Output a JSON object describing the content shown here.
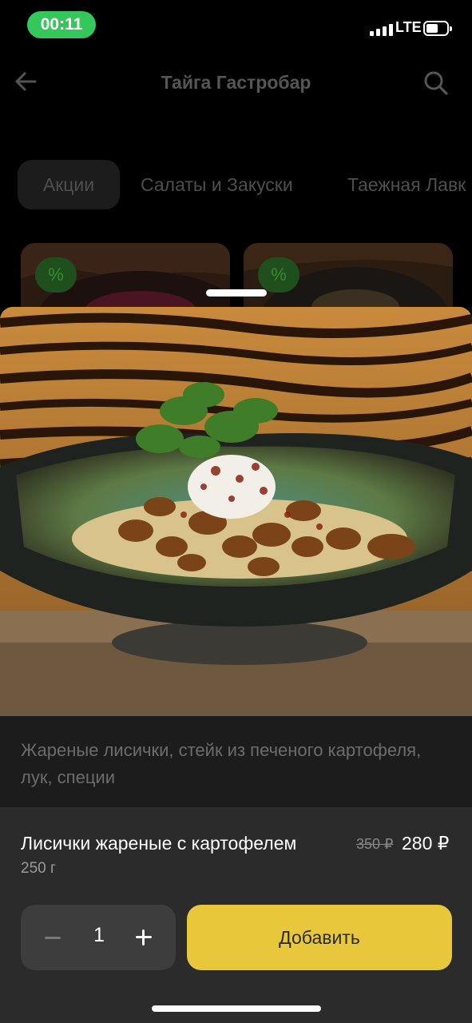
{
  "status_bar": {
    "time": "00:11",
    "network": "LTE"
  },
  "header": {
    "title": "Тайга Гастробар",
    "back_icon": "arrow-left-icon",
    "search_icon": "search-icon"
  },
  "tabs": [
    {
      "label": "Акции",
      "active": true
    },
    {
      "label": "Салаты и Закуски",
      "active": false
    },
    {
      "label": "Таежная Лавк",
      "active": false
    }
  ],
  "cards": [
    {
      "badge": "%"
    },
    {
      "badge": "%"
    }
  ],
  "product": {
    "description": "Жареные лисички, стейк из печеного картофеля, лук, специи",
    "name": "Лисички жареные с картофелем",
    "weight": "250 г",
    "old_price": "350 ₽",
    "price": "280 ₽",
    "quantity": "1",
    "add_label": "Добавить"
  },
  "colors": {
    "accent_yellow": "#e8c83a",
    "status_green": "#34c759",
    "discount_green": "#1f4f1c"
  }
}
